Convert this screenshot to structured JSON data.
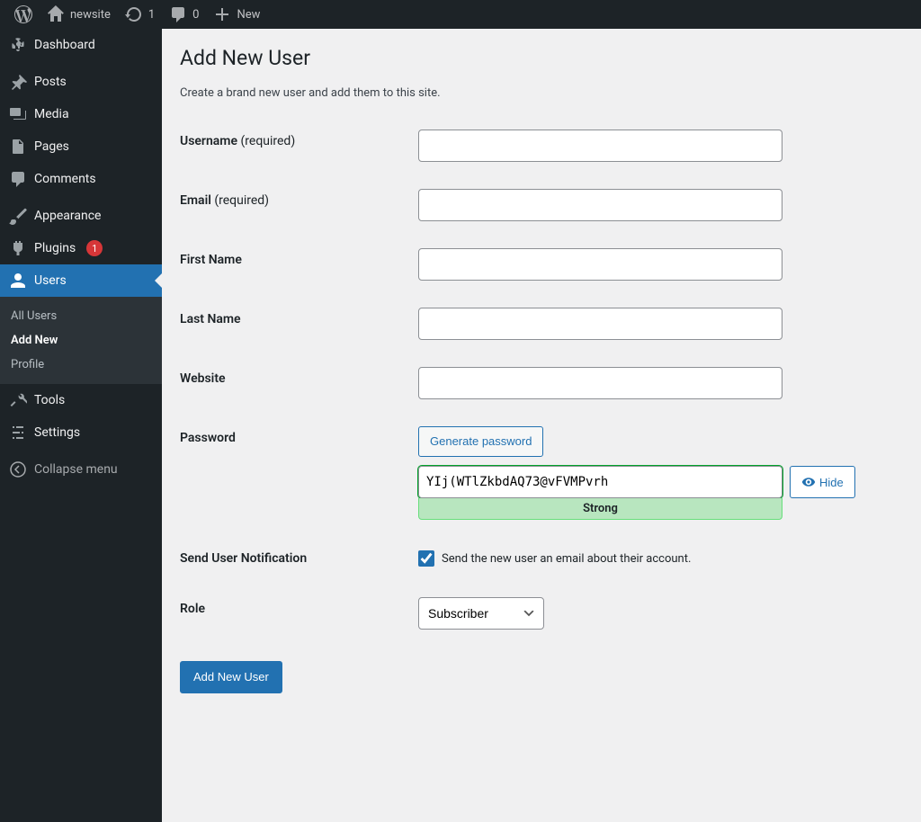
{
  "adminbar": {
    "site_name": "newsite",
    "updates": "1",
    "comments": "0",
    "new_label": "New"
  },
  "sidebar": {
    "dashboard": "Dashboard",
    "posts": "Posts",
    "media": "Media",
    "pages": "Pages",
    "comments": "Comments",
    "appearance": "Appearance",
    "plugins": "Plugins",
    "plugins_badge": "1",
    "users": "Users",
    "tools": "Tools",
    "settings": "Settings",
    "collapse": "Collapse menu",
    "submenu": {
      "all_users": "All Users",
      "add_new": "Add New",
      "profile": "Profile"
    }
  },
  "page": {
    "title": "Add New User",
    "description": "Create a brand new user and add them to this site.",
    "labels": {
      "username": "Username",
      "username_req": "(required)",
      "email": "Email",
      "email_req": "(required)",
      "first_name": "First Name",
      "last_name": "Last Name",
      "website": "Website",
      "password": "Password",
      "notification": "Send User Notification",
      "role": "Role"
    },
    "generate_pwd": "Generate password",
    "password_value": "YIj(WTlZkbdAQ73@vFVMPvrh",
    "strength": "Strong",
    "hide": "Hide",
    "notification_text": "Send the new user an email about their account.",
    "role_value": "Subscriber",
    "submit": "Add New User"
  }
}
